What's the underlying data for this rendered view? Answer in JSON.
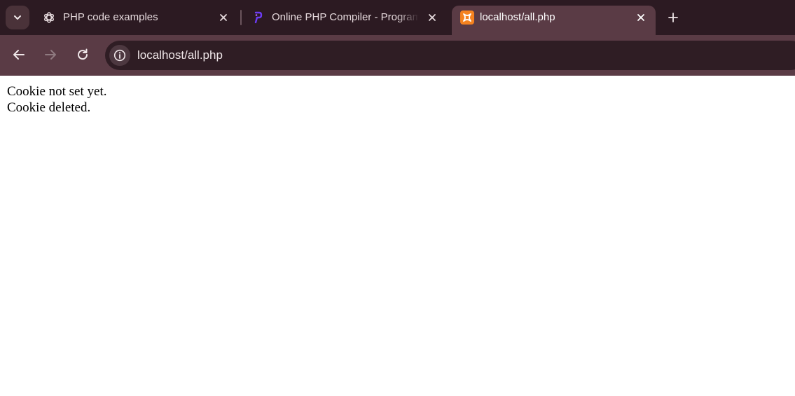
{
  "browser": {
    "tabs": [
      {
        "title": "PHP code examples",
        "icon": "chatgpt-icon"
      },
      {
        "title": "Online PHP Compiler - Programiz",
        "icon": "programiz-icon"
      },
      {
        "title": "localhost/all.php",
        "icon": "xampp-icon",
        "active": true
      }
    ],
    "address_bar": {
      "url": "localhost/all.php"
    }
  },
  "page": {
    "lines": [
      "Cookie not set yet.",
      "Cookie deleted."
    ]
  },
  "colors": {
    "tabstrip": "#2c1a22",
    "toolbar": "#5a3b45",
    "omnibox": "#2f1d24",
    "xampp_orange": "#f5821f",
    "programiz_purple": "#6c3bf5"
  }
}
